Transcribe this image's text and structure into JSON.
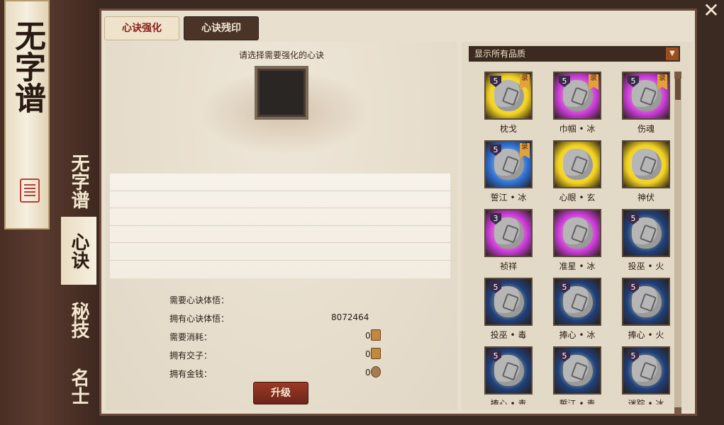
{
  "app": {
    "banner_title": "无字谱",
    "side_nav": [
      {
        "label": "无字谱",
        "active": false
      },
      {
        "label": "心诀",
        "active": true
      },
      {
        "label": "秘技",
        "active": false
      },
      {
        "label": "名士",
        "active": false
      }
    ],
    "close_label": "✕"
  },
  "tabs": {
    "enhance_label": "心诀强化",
    "residue_label": "心诀残印"
  },
  "enhance_panel": {
    "prompt": "请选择需要强化的心诀",
    "stats": [
      {
        "label": "需要心诀体悟：",
        "value": ""
      },
      {
        "label": "拥有心诀体悟：",
        "value": "8072464"
      },
      {
        "label": "需要消耗：",
        "value": "0"
      },
      {
        "label": "拥有交子：",
        "value": "0"
      },
      {
        "label": "拥有金钱：",
        "value": "0"
      }
    ],
    "upgrade_label": "升级"
  },
  "filter": {
    "label": "显示所有品质",
    "button_icon": "dropdown-arrow-icon"
  },
  "grid_items": [
    {
      "name": "枕戈",
      "level": "5",
      "tag": "录",
      "bg": "#f0d020"
    },
    {
      "name": "巾帼 • 冰",
      "level": "5",
      "tag": "录",
      "bg": "#c83ad8"
    },
    {
      "name": "伤魂",
      "level": "5",
      "tag": "录",
      "bg": "#c83ad8"
    },
    {
      "name": "誓江 • 冰",
      "level": "5",
      "tag": "录",
      "bg": "#2b6fd6"
    },
    {
      "name": "心眼 • 玄",
      "level": "",
      "tag": "",
      "bg": "#f0d020"
    },
    {
      "name": "神伏",
      "level": "",
      "tag": "",
      "bg": "#f0d020"
    },
    {
      "name": "祯祥",
      "level": "3",
      "tag": "",
      "bg": "#c83ad8"
    },
    {
      "name": "准星 • 冰",
      "level": "",
      "tag": "",
      "bg": "#c83ad8"
    },
    {
      "name": "投巫 • 火",
      "level": "5",
      "tag": "",
      "bg": "#1e3f7a"
    },
    {
      "name": "投巫 • 毒",
      "level": "5",
      "tag": "",
      "bg": "#1e3f7a"
    },
    {
      "name": "捧心 • 冰",
      "level": "5",
      "tag": "",
      "bg": "#1e3f7a"
    },
    {
      "name": "捧心 • 火",
      "level": "5",
      "tag": "",
      "bg": "#1e3f7a"
    },
    {
      "name": "捧心 • 毒",
      "level": "5",
      "tag": "",
      "bg": "#1e3f7a"
    },
    {
      "name": "誓江 • 毒",
      "level": "5",
      "tag": "",
      "bg": "#1e3f7a"
    },
    {
      "name": "迷踪 • 冰",
      "level": "5",
      "tag": "",
      "bg": "#1e3f7a"
    }
  ],
  "colors": {
    "accent_red": "#8a1d16",
    "frame_brown": "#4a2f26"
  }
}
